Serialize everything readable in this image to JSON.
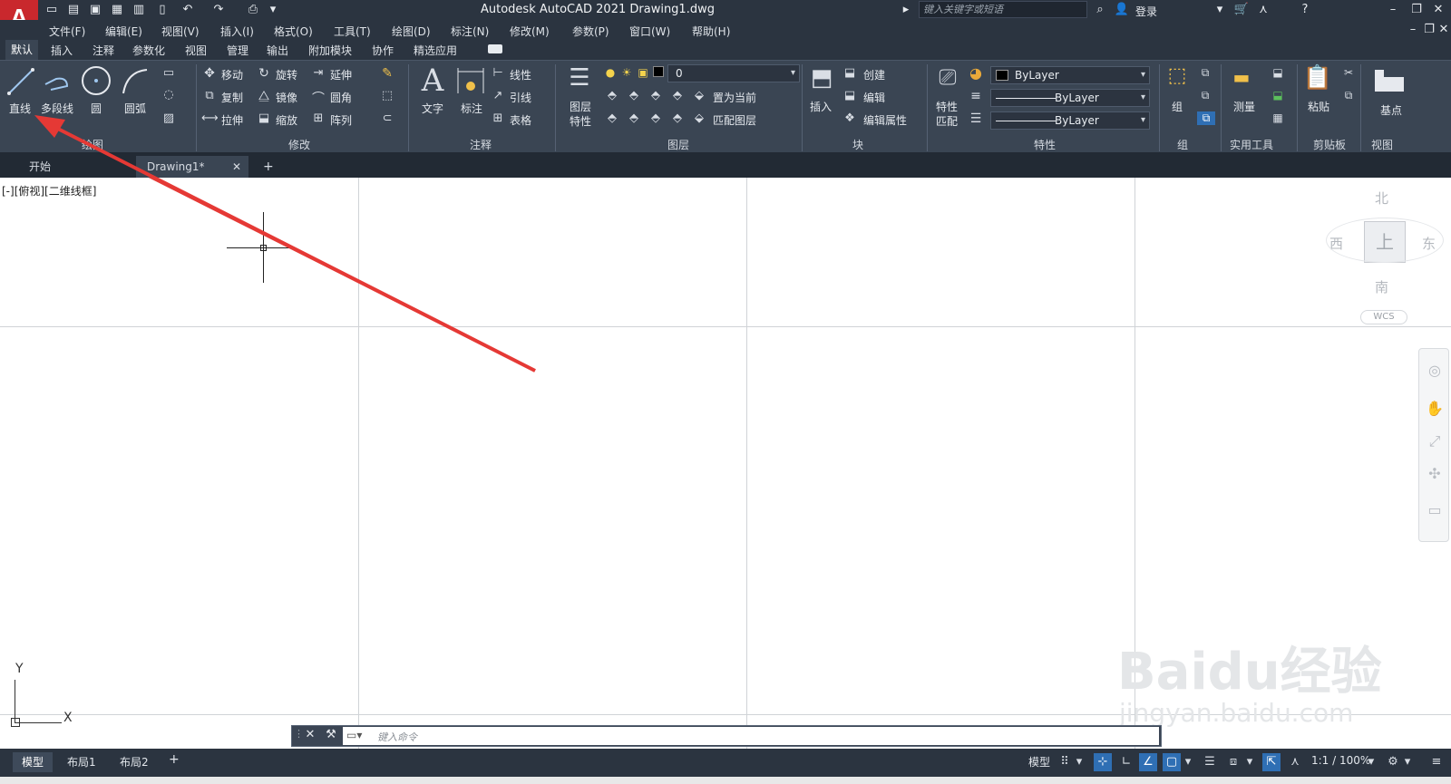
{
  "app": {
    "logo_letter": "A",
    "title": "Autodesk AutoCAD 2021    Drawing1.dwg",
    "search_placeholder": "键入关键字或短语",
    "login_label": "登录"
  },
  "menu": [
    "文件(F)",
    "编辑(E)",
    "视图(V)",
    "插入(I)",
    "格式(O)",
    "工具(T)",
    "绘图(D)",
    "标注(N)",
    "修改(M)",
    "参数(P)",
    "窗口(W)",
    "帮助(H)"
  ],
  "ribbon_tabs": [
    "默认",
    "插入",
    "注释",
    "参数化",
    "视图",
    "管理",
    "输出",
    "附加模块",
    "协作",
    "精选应用"
  ],
  "ribbon": {
    "draw": {
      "line": "直线",
      "polyline": "多段线",
      "circle": "圆",
      "arc": "圆弧",
      "title": "绘图"
    },
    "modify": {
      "move": "移动",
      "rotate": "旋转",
      "extend": "延伸",
      "copy": "复制",
      "mirror": "镜像",
      "fillet": "圆角",
      "stretch": "拉伸",
      "scale": "缩放",
      "array": "阵列",
      "title": "修改"
    },
    "annotation": {
      "text": "文字",
      "dimension": "标注",
      "linear": "线性",
      "leader": "引线",
      "table": "表格",
      "title": "注释"
    },
    "layers": {
      "properties_l1": "图层",
      "properties_l2": "特性",
      "current_layer": "0",
      "set_current": "置为当前",
      "match_layer": "匹配图层",
      "title": "图层"
    },
    "block": {
      "insert": "插入",
      "create": "创建",
      "edit": "编辑",
      "edit_attr": "编辑属性",
      "title": "块"
    },
    "properties": {
      "match_l1": "特性",
      "match_l2": "匹配",
      "color": "ByLayer",
      "linetype": "ByLayer",
      "lineweight": "ByLayer",
      "title": "特性"
    },
    "groups": {
      "group": "组",
      "title": "组"
    },
    "utilities": {
      "measure": "测量",
      "title": "实用工具"
    },
    "clipboard": {
      "paste": "粘贴",
      "title": "剪贴板"
    },
    "view": {
      "base": "基点",
      "title": "视图"
    }
  },
  "doc_tabs": {
    "start": "开始",
    "drawing": "Drawing1*"
  },
  "viewport": {
    "label": "[-][俯视][二维线框]",
    "viewcube": {
      "north": "北",
      "south": "南",
      "east": "东",
      "west": "西",
      "top": "上",
      "wcs": "WCS"
    },
    "ucs_x": "X",
    "ucs_y": "Y",
    "command_placeholder": "键入命令",
    "watermark": "Baidu经验",
    "watermark_url": "jingyan.baidu.com"
  },
  "status": {
    "layouts": [
      "模型",
      "布局1",
      "布局2"
    ],
    "model_label": "模型",
    "scale": "1:1 / 100%"
  },
  "colors": {
    "chrome": "#2b3440",
    "ribbon": "#3a4553",
    "accent": "#2f6fb4",
    "logo": "#c9282d",
    "annotation_arrow": "#e53935"
  }
}
